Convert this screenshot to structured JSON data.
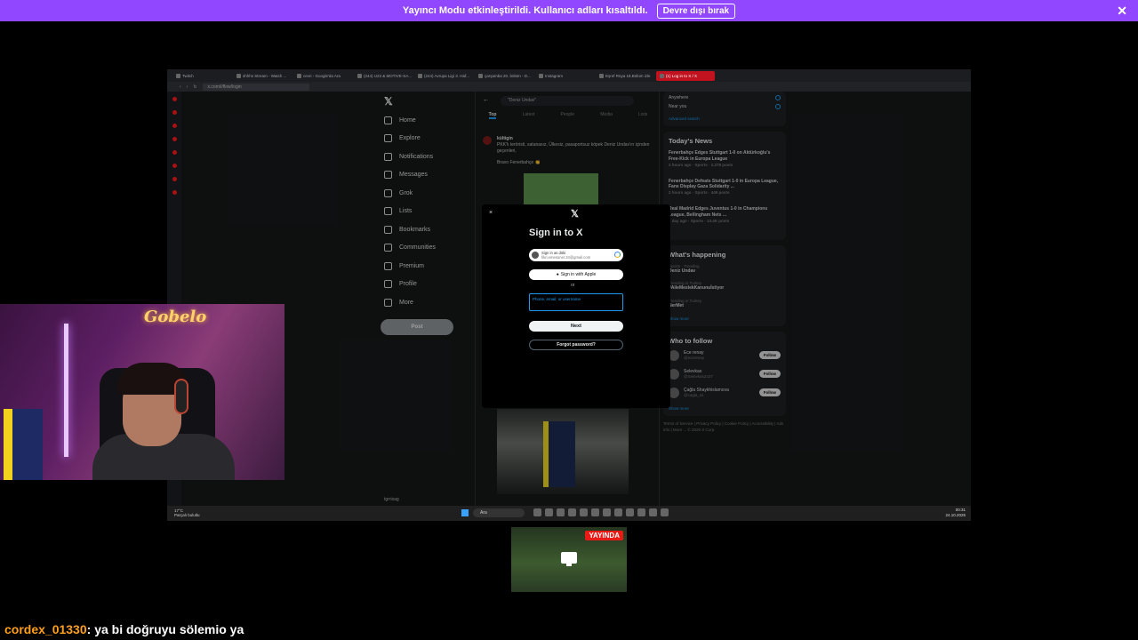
{
  "banner": {
    "message": "Yayıncı Modu etkinleştirildi. Kullanıcı adları kısaltıldı.",
    "button": "Devre dışı bırak",
    "close": "✕"
  },
  "browser": {
    "tabs": [
      "Twitch",
      "shhhs Stream - Watch ...",
      "cevri - Google'da Ara",
      "(244) U23 & MOTIVE-SA...",
      "(244) Avrupa Ligi 3. Haf...",
      "çarşamba 20. bölüm - D...",
      "Instagram",
      "Eşref Rüya 18.Bölüm izle",
      "(1) Log in to X / X"
    ],
    "url": "x.com/i/flow/login"
  },
  "x": {
    "logo": "𝕏",
    "nav": [
      "Home",
      "Explore",
      "Notifications",
      "Messages",
      "Grok",
      "Lists",
      "Bookmarks",
      "Communities",
      "Premium",
      "Profile",
      "More"
    ],
    "post_button": "Post",
    "search_value": "\"Deniz Undav\"",
    "feed_tabs": [
      "Top",
      "Latest",
      "People",
      "Media",
      "Lists"
    ],
    "tweet": {
      "author": "kültigin",
      "text": "PKK'lı teröristi, satanasız, Ülkesiz, pasaportsuz köpek Deniz Undav'ın içinden geçenleri,",
      "subtext": "Bravo Fenerbahçe 👏"
    },
    "sidebar": {
      "location_options": [
        "Anywhere",
        "Near you"
      ],
      "advanced_search": "Advanced search",
      "todays_news_title": "Today's News",
      "news": [
        {
          "headline": "Fenerbahçe Edges Stuttgart 1-0 on Aktürkoğlu's Free-Kick in Europa League",
          "meta": "2 hours ago · Sports · 2,378 posts"
        },
        {
          "headline": "Fenerbahçe Defeats Stuttgart 1-0 in Europa League, Fans Display Gaza Solidarity ...",
          "meta": "2 hours ago · Sports · 449 posts"
        },
        {
          "headline": "Real Madrid Edges Juventus 1-0 in Champions League, Bellingham Nets ...",
          "meta": "1 day ago · Sports · 13.4K posts"
        }
      ],
      "whats_happening_title": "What's happening",
      "trends": [
        {
          "context": "Sports · Trending",
          "name": "Deniz Undav",
          "count": ""
        },
        {
          "context": "Trending in Turkey",
          "name": "#AileMeslekKanunuİstiyor",
          "count": ""
        },
        {
          "context": "Trending in Turkey",
          "name": "NerMet",
          "count": ""
        }
      ],
      "show_more": "Show more",
      "who_to_follow_title": "Who to follow",
      "follow": [
        {
          "name": "Ece renay",
          "handle": "@ecerenay"
        },
        {
          "name": "Selevkas",
          "handle": "@Selevkas2437"
        },
        {
          "name": "Çağla Shaykhislamova",
          "handle": "@cagla_ss"
        }
      ],
      "follow_button": "Follow",
      "show_more_2": "Show more",
      "footer": "Terms of Service | Privacy Policy | Cookie Policy | Accessibility | Ads info | More ... © 2025 X Corp."
    },
    "account_name": "tgrrisag"
  },
  "login_modal": {
    "close": "×",
    "logo": "𝕏",
    "title": "Sign in to X",
    "google_line1": "Sign in as döki",
    "google_line2": "fikri.emesoner.34@gmail.com",
    "apple_label": "Sign in with Apple",
    "or": "or",
    "field_placeholder": "Phone, email, or username",
    "next_label": "Next",
    "forgot_label": "Forgot password?"
  },
  "taskbar": {
    "weather_temp": "17°C",
    "weather_desc": "Parçalı bulutlu",
    "search": "Ara",
    "time": "00:31",
    "date": "24.10.2025"
  },
  "webcam": {
    "neon_sign": "Gobelo"
  },
  "stream_preview": {
    "live_badge": "YAYINDA"
  },
  "chat": {
    "username": "cordex_01330",
    "message": ": ya bi doğruyu sölemio ya"
  }
}
